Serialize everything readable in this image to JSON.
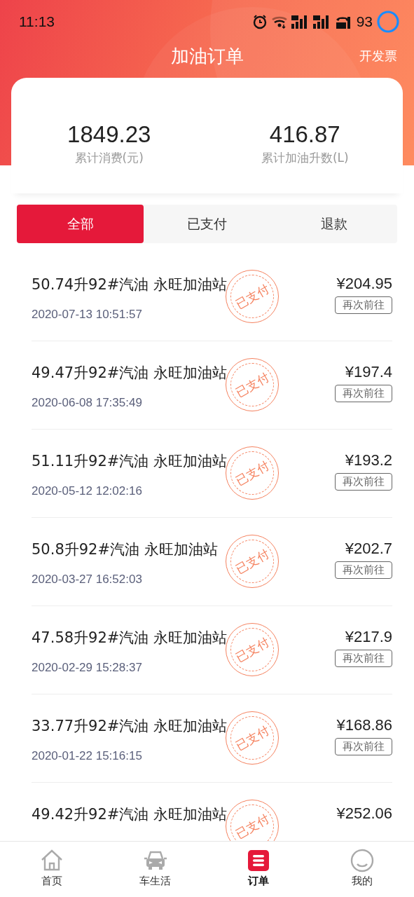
{
  "status_bar": {
    "time": "11:13",
    "battery": "93"
  },
  "header": {
    "title": "加油订单",
    "action": "开发票"
  },
  "summary": [
    {
      "value": "1849.23",
      "label": "累计消费(元)"
    },
    {
      "value": "416.87",
      "label": "累计加油升数(L)"
    }
  ],
  "tabs": [
    {
      "label": "全部",
      "selected": true
    },
    {
      "label": "已支付",
      "selected": false
    },
    {
      "label": "退款",
      "selected": false
    }
  ],
  "orders": [
    {
      "title": "50.74升92#汽油 永旺加油站",
      "date": "2020-07-13 10:51:57",
      "price": "¥204.95",
      "stamp": "已支付",
      "button": "再次前往"
    },
    {
      "title": "49.47升92#汽油 永旺加油站",
      "date": "2020-06-08 17:35:49",
      "price": "¥197.4",
      "stamp": "已支付",
      "button": "再次前往"
    },
    {
      "title": "51.11升92#汽油 永旺加油站",
      "date": "2020-05-12 12:02:16",
      "price": "¥193.2",
      "stamp": "已支付",
      "button": "再次前往"
    },
    {
      "title": "50.8升92#汽油 永旺加油站",
      "date": "2020-03-27 16:52:03",
      "price": "¥202.7",
      "stamp": "已支付",
      "button": "再次前往"
    },
    {
      "title": "47.58升92#汽油 永旺加油站",
      "date": "2020-02-29 15:28:37",
      "price": "¥217.9",
      "stamp": "已支付",
      "button": "再次前往"
    },
    {
      "title": "33.77升92#汽油 永旺加油站",
      "date": "2020-01-22 15:16:15",
      "price": "¥168.86",
      "stamp": "已支付",
      "button": "再次前往"
    },
    {
      "title": "49.42升92#汽油 永旺加油站",
      "price": "¥252.06",
      "stamp": "已支付"
    }
  ],
  "nav": [
    {
      "kind": "home",
      "label": "首页",
      "selected": false
    },
    {
      "kind": "car",
      "label": "车生活",
      "selected": false
    },
    {
      "kind": "orders",
      "label": "订单",
      "selected": true
    },
    {
      "kind": "profile",
      "label": "我的",
      "selected": false
    }
  ]
}
